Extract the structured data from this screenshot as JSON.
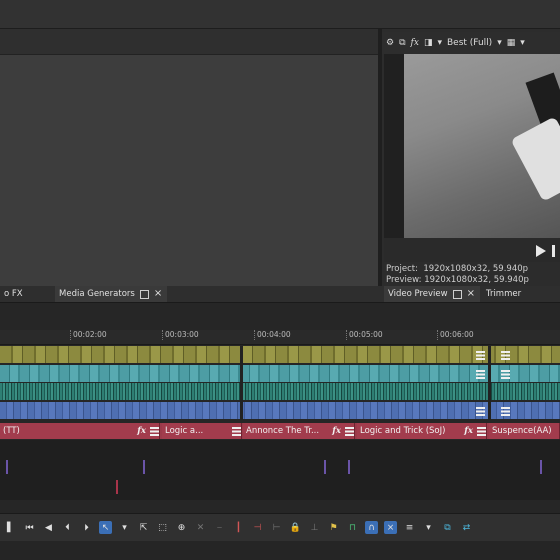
{
  "preview_toolbar": {
    "quality": "Best (Full)"
  },
  "preview_info": {
    "project_label": "Project:",
    "project_value": "1920x1080x32, 59.940p",
    "preview_label": "Preview:",
    "preview_value": "1920x1080x32, 59.940p"
  },
  "tabs": {
    "video_fx": "o FX",
    "media_generators": "Media Generators",
    "video_preview": "Video Preview",
    "trimmer": "Trimmer"
  },
  "ruler": {
    "ticks": [
      "00:02:00",
      "00:03:00",
      "00:04:00",
      "00:05:00",
      "00:06:00"
    ]
  },
  "music_clips": [
    {
      "label": "(TT)"
    },
    {
      "label": "Logic a..."
    },
    {
      "label": "Annonce The Tr..."
    },
    {
      "label": "Logic and Trick (SoJ)"
    },
    {
      "label": "Suspence(AA)"
    }
  ],
  "fx_label": "fx",
  "colors": {
    "accent": "#3b6fb6",
    "music_track": "#a23c4d",
    "video_track_1": "#8c8a3f",
    "video_track_2": "#4d9da4",
    "video_track_3": "#2e7f74",
    "video_track_4": "#4f6fb2"
  }
}
